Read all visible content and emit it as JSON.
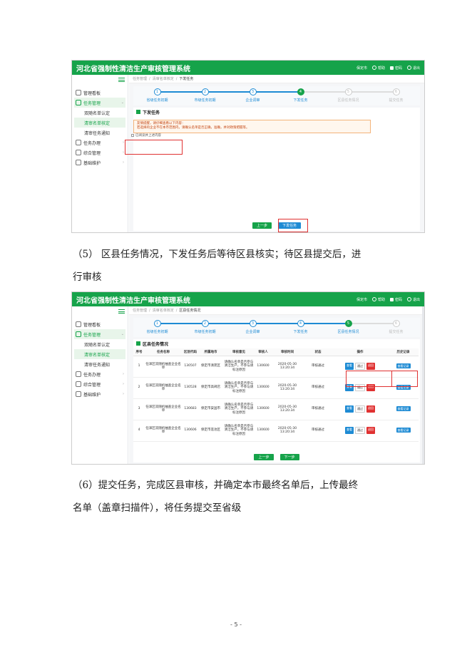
{
  "app": {
    "title": "河北省强制性清洁生产审核管理系统",
    "tools": [
      "保定市",
      "帮助",
      "密码",
      "退出"
    ]
  },
  "sidebar": {
    "items": [
      {
        "label": "管理看板",
        "arrow": ""
      },
      {
        "label": "任务管理",
        "arrow": "⌄"
      },
      {
        "label": "双随名单认定",
        "sub": true
      },
      {
        "label": "清审名单核定",
        "sub": true
      },
      {
        "label": "清审任务通知",
        "sub": true
      },
      {
        "label": "任务办理",
        "arrow": "›"
      },
      {
        "label": "综合管理",
        "arrow": "›"
      },
      {
        "label": "基础维护",
        "arrow": "›"
      }
    ]
  },
  "steps": [
    "省级任务初期",
    "市级任务初期",
    "企业调审",
    "下发任务",
    "区县任务情况",
    "提交任务"
  ],
  "screen1": {
    "breadcrumb": [
      "任务管理",
      "清审名单核定",
      "下发任务"
    ],
    "panel_title": "下发任务",
    "notice_line1": "友情提醒，请仔细查看以下内容：",
    "notice_line2": "若选择的企业不在本市范围内，请确认名单是否正确，准确，并对政策把握等。",
    "checkbox_label": "已阅读并上述内容",
    "buttons": {
      "prev": "上一步",
      "next": "下发任务"
    }
  },
  "caption1_line1": "（5）  区县任务情况，下发任务后等待区县核实；待区县提交后，进",
  "caption1_line2": "行审核",
  "screen2": {
    "breadcrumb": [
      "任务管理",
      "清审名单核定",
      "区县任务情况"
    ],
    "panel_title": "区县任务情况",
    "table": {
      "headers": [
        "序号",
        "任务名称",
        "区划代码",
        "所属地市",
        "审核意见",
        "审核人",
        "审核时间",
        "状态",
        "操作",
        "历史记录"
      ],
      "rows": [
        {
          "no": "1",
          "name": "任泽区双随机抽查企业名单",
          "code": "130507",
          "city": "保定市清苑区",
          "opinion": "请确认名单是否参与清洁生产，不参与请标注原因",
          "auditor": "130600",
          "time": "2020-05-30 13:20:34",
          "status": "审核通过"
        },
        {
          "no": "2",
          "name": "任泽区双随机抽查企业名单",
          "code": "130528",
          "city": "保定市高碑店",
          "opinion": "请确认名单是否参与清洁生产，不参与请标注原因",
          "auditor": "130600",
          "time": "2020-05-30 13:20:34",
          "status": "审核通过"
        },
        {
          "no": "3",
          "name": "任泽区双随机抽查企业名单",
          "code": "130683",
          "city": "保定市安国市",
          "opinion": "请确认名单是否参与清洁生产，不参与请标注原因",
          "auditor": "130600",
          "time": "2020-05-30 13:20:34",
          "status": "审核通过"
        },
        {
          "no": "4",
          "name": "任泽区双随机抽查企业名单",
          "code": "130606",
          "city": "保定市莲池区",
          "opinion": "请确认名单是否参与清洁生产，不参与请标注原因",
          "auditor": "130600",
          "time": "2020-05-30 13:20:34",
          "status": "审核通过"
        }
      ],
      "ops": [
        "查看",
        "通过",
        "退回"
      ],
      "history": "查看记录"
    },
    "buttons": {
      "prev": "上一步",
      "next": "下一步"
    }
  },
  "caption2_line1": "（6）提交任务，完成区县审核，并确定本市最终名单后，上传最终",
  "caption2_line2": "名单（盖章扫描件），将任务提交至省级",
  "page_number": "- 5 -"
}
